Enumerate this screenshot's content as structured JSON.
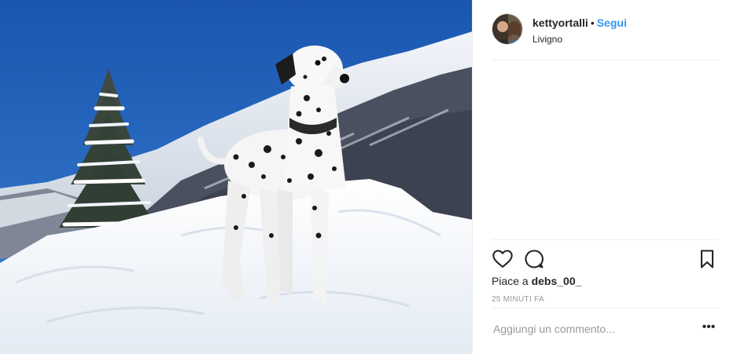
{
  "post": {
    "username": "kettyortalli",
    "separator": "•",
    "follow_label": "Segui",
    "location": "Livigno",
    "likes_prefix": "Piace a ",
    "liker": "debs_00_",
    "timestamp": "25 MINUTI FA",
    "comment_placeholder": "Aggiungi un commento...",
    "more_label": "•••"
  },
  "icons": {
    "like": "heart-icon",
    "comment": "comment-bubble-icon",
    "save": "bookmark-icon",
    "more": "more-options-icon"
  },
  "colors": {
    "accent": "#3897f0",
    "text": "#262626",
    "muted": "#999999",
    "divider": "#efefef",
    "sky": "#1f5fb8"
  }
}
